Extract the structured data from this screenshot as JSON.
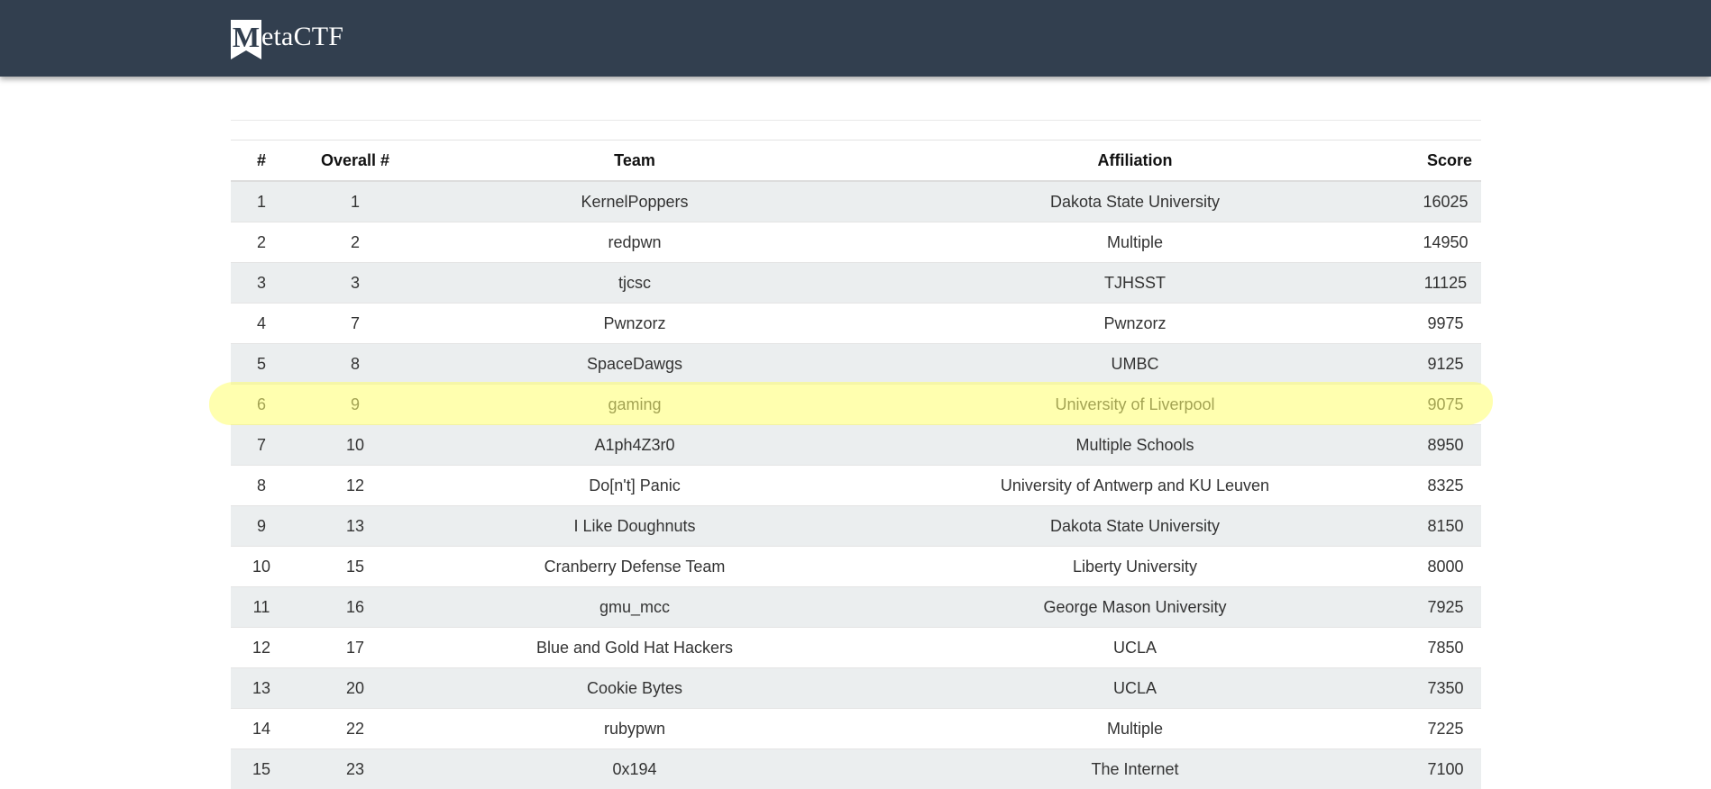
{
  "brand": {
    "logo_letter": "M",
    "name": "etaCTF"
  },
  "table": {
    "headers": {
      "rank": "#",
      "overall": "Overall #",
      "team": "Team",
      "affiliation": "Affiliation",
      "score": "Score"
    },
    "rows": [
      {
        "rank": "1",
        "overall": "1",
        "team": "KernelPoppers",
        "affiliation": "Dakota State University",
        "score": "16025"
      },
      {
        "rank": "2",
        "overall": "2",
        "team": "redpwn",
        "affiliation": "Multiple",
        "score": "14950"
      },
      {
        "rank": "3",
        "overall": "3",
        "team": "tjcsc",
        "affiliation": "TJHSST",
        "score": "11125"
      },
      {
        "rank": "4",
        "overall": "7",
        "team": "Pwnzorz",
        "affiliation": "Pwnzorz",
        "score": "9975"
      },
      {
        "rank": "5",
        "overall": "8",
        "team": "SpaceDawgs",
        "affiliation": "UMBC",
        "score": "9125"
      },
      {
        "rank": "6",
        "overall": "9",
        "team": "gaming",
        "affiliation": "University of Liverpool",
        "score": "9075"
      },
      {
        "rank": "7",
        "overall": "10",
        "team": "A1ph4Z3r0",
        "affiliation": "Multiple Schools",
        "score": "8950"
      },
      {
        "rank": "8",
        "overall": "12",
        "team": "Do[n't] Panic",
        "affiliation": "University of Antwerp and KU Leuven",
        "score": "8325"
      },
      {
        "rank": "9",
        "overall": "13",
        "team": "I Like Doughnuts",
        "affiliation": "Dakota State University",
        "score": "8150"
      },
      {
        "rank": "10",
        "overall": "15",
        "team": "Cranberry Defense Team",
        "affiliation": "Liberty University",
        "score": "8000"
      },
      {
        "rank": "11",
        "overall": "16",
        "team": "gmu_mcc",
        "affiliation": "George Mason University",
        "score": "7925"
      },
      {
        "rank": "12",
        "overall": "17",
        "team": "Blue and Gold Hat Hackers",
        "affiliation": "UCLA",
        "score": "7850"
      },
      {
        "rank": "13",
        "overall": "20",
        "team": "Cookie Bytes",
        "affiliation": "UCLA",
        "score": "7350"
      },
      {
        "rank": "14",
        "overall": "22",
        "team": "rubypwn",
        "affiliation": "Multiple",
        "score": "7225"
      },
      {
        "rank": "15",
        "overall": "23",
        "team": "0x194",
        "affiliation": "The Internet",
        "score": "7100"
      }
    ],
    "highlighted_row_rank": "6",
    "highlight_color": "#ffff6e"
  }
}
